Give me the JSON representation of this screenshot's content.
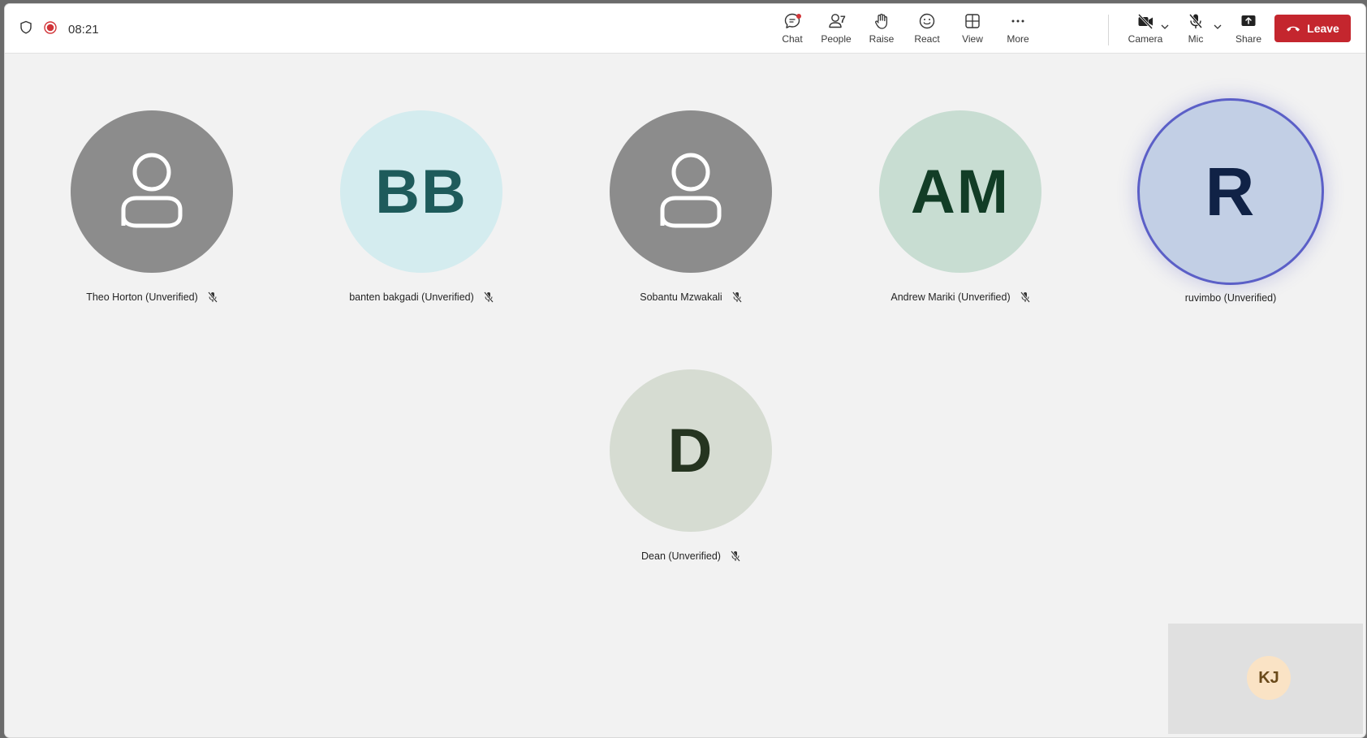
{
  "toolbar": {
    "timer": "08:21",
    "chat_label": "Chat",
    "people_label": "People",
    "people_count": "7",
    "raise_label": "Raise",
    "react_label": "React",
    "view_label": "View",
    "more_label": "More",
    "camera_label": "Camera",
    "mic_label": "Mic",
    "share_label": "Share",
    "leave_label": "Leave"
  },
  "participants": [
    {
      "name": "Theo Horton (Unverified)",
      "initials": "",
      "avatar_color": "#8c8c8c",
      "text_color": "#ffffff",
      "muted": true
    },
    {
      "name": "banten bakgadi (Unverified)",
      "initials": "BB",
      "avatar_color": "#d4ecef",
      "text_color": "#1e5b5b",
      "muted": true
    },
    {
      "name": "Sobantu Mzwakali",
      "initials": "",
      "avatar_color": "#8c8c8c",
      "text_color": "#ffffff",
      "muted": true
    },
    {
      "name": "Andrew Mariki (Unverified)",
      "initials": "AM",
      "avatar_color": "#c8ddd2",
      "text_color": "#123d26",
      "muted": true
    },
    {
      "name": "ruvimbo (Unverified)",
      "initials": "R",
      "avatar_color": "#c2cfe5",
      "text_color": "#102246",
      "muted": false,
      "speaking": true
    },
    {
      "name": "Dean (Unverified)",
      "initials": "D",
      "avatar_color": "#d6dcd2",
      "text_color": "#253420",
      "muted": true
    }
  ],
  "self_view": {
    "initials": "KJ",
    "avatar_color": "#fae3c5"
  },
  "colors": {
    "leave": "#c4262e",
    "recording": "#d13438",
    "active_ring": "#5b5fc7"
  }
}
